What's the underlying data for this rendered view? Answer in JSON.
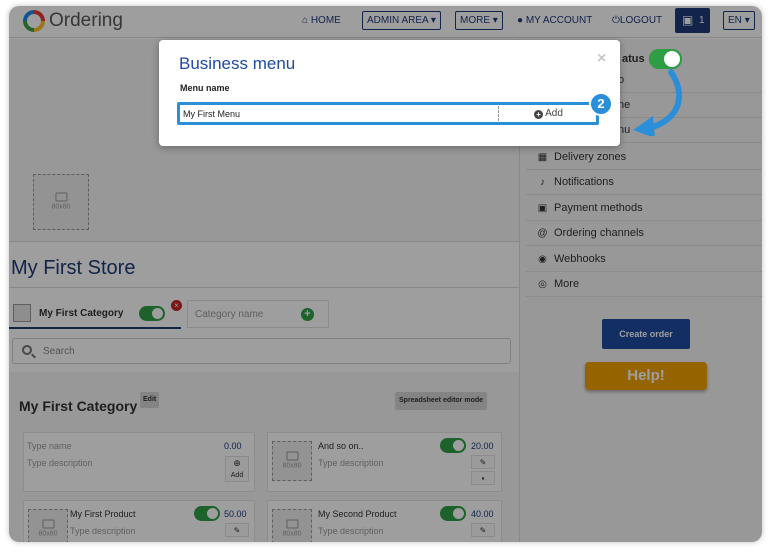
{
  "header": {
    "brand": "Ordering",
    "home": "HOME",
    "admin_area": "ADMIN AREA",
    "more": "MORE",
    "my_account": "MY ACCOUNT",
    "logout": "LOGOUT",
    "cart_count": "1",
    "language": "EN"
  },
  "image_placeholder": "80x80",
  "store": {
    "name": "My First Store"
  },
  "category_tab": {
    "label": "My First Category",
    "delete_glyph": "×"
  },
  "new_category": {
    "placeholder": "Category name",
    "add_glyph": "+"
  },
  "search": {
    "placeholder": "Search"
  },
  "category_section": {
    "title": "My First Category",
    "edit": "Edit",
    "spreadsheet": "Spreadsheet editor mode"
  },
  "new_product_card": {
    "name_placeholder": "Type name",
    "price": "0.00",
    "desc_placeholder": "Type description",
    "add_label": "Add"
  },
  "products": [
    {
      "name": "And so on..",
      "price": "20.00",
      "desc": "Type description"
    },
    {
      "name": "My First Product",
      "price": "50.00",
      "desc": "Type description"
    },
    {
      "name": "My Second Product",
      "price": "40.00",
      "desc": "Type description"
    }
  ],
  "sidebar": {
    "status_label": "atus",
    "partial_items": [
      "o",
      "ne",
      "nu"
    ],
    "items": [
      {
        "label": "Delivery zones",
        "icon": "map-icon"
      },
      {
        "label": "Notifications",
        "icon": "bell-icon"
      },
      {
        "label": "Payment methods",
        "icon": "money-icon"
      },
      {
        "label": "Ordering channels",
        "icon": "at-icon"
      },
      {
        "label": "Webhooks",
        "icon": "globe-icon"
      },
      {
        "label": "More",
        "icon": "dot-circle-icon"
      }
    ],
    "create_order": "Create order",
    "help": "Help!"
  },
  "modal": {
    "title": "Business menu",
    "close": "×",
    "field_label": "Menu name",
    "input_value": "My First Menu",
    "add_button": "Add"
  },
  "step_badge": "2",
  "colors": {
    "primary": "#1e3a78",
    "highlight": "#2a8fd8",
    "toggle_on": "#2e9e45",
    "help": "#f0a000"
  }
}
